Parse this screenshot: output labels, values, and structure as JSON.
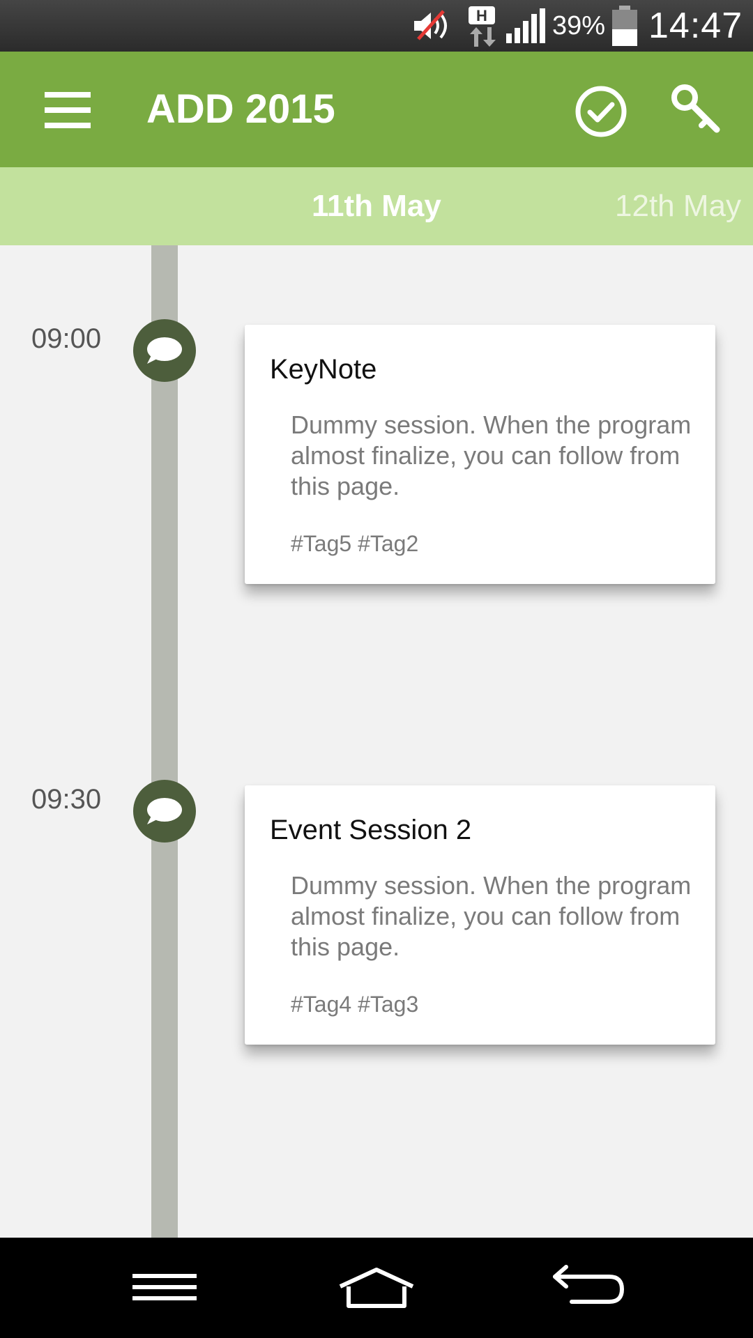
{
  "status_bar": {
    "battery_text": "39%",
    "time": "14:47",
    "icons": [
      "mute-icon",
      "hspa-data-icon",
      "signal-icon",
      "battery-icon"
    ]
  },
  "app_bar": {
    "title": "ADD 2015",
    "background_color": "#7aab42",
    "icons": [
      "menu-icon",
      "check-circle-icon",
      "key-icon"
    ]
  },
  "date_tabs": {
    "tabs": [
      {
        "label": "11th May",
        "active": true
      },
      {
        "label": "12th May",
        "active": false
      }
    ],
    "background_color": "#c2e19d"
  },
  "sessions": [
    {
      "time": "09:00",
      "title": "KeyNote",
      "description": "Dummy session. When the program almost finalize, you can follow from this page.",
      "tags": "#Tag5 #Tag2",
      "icon": "speech-bubble-icon"
    },
    {
      "time": "09:30",
      "title": "Event Session 2",
      "description": "Dummy session. When the program almost finalize, you can follow from this page.",
      "tags": "#Tag4 #Tag3",
      "icon": "speech-bubble-icon"
    }
  ],
  "nav_bar": {
    "icons": [
      "nav-menu-icon",
      "nav-home-icon",
      "nav-back-icon"
    ]
  }
}
